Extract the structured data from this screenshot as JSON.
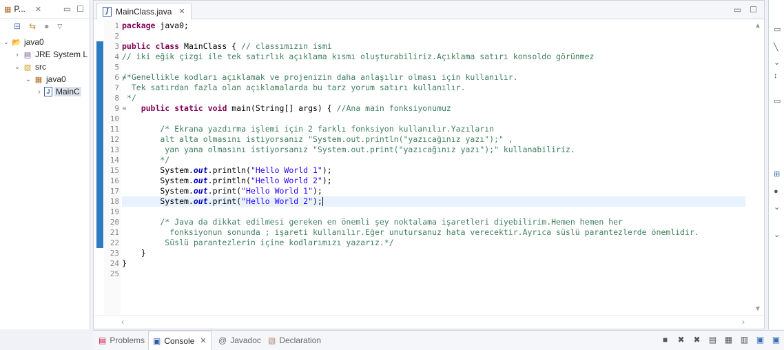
{
  "package_explorer": {
    "tab_title": "P...",
    "tree": [
      {
        "label": "java0",
        "level": 0,
        "expanded": true,
        "icon": "project-icon"
      },
      {
        "label": "JRE System L",
        "level": 1,
        "expanded": false,
        "icon": "library-icon"
      },
      {
        "label": "src",
        "level": 1,
        "expanded": true,
        "icon": "source-folder-icon"
      },
      {
        "label": "java0",
        "level": 2,
        "expanded": true,
        "icon": "package-icon"
      },
      {
        "label": "MainC",
        "level": 3,
        "expanded": false,
        "icon": "java-file-icon",
        "selected": true
      }
    ]
  },
  "editor": {
    "tab_title": "MainClass.java",
    "highlighted_line": 18,
    "line_numbers": [
      "1",
      "2",
      "3",
      "4",
      "5",
      "6",
      "7",
      "8",
      "9",
      "10",
      "11",
      "12",
      "13",
      "14",
      "15",
      "16",
      "17",
      "18",
      "19",
      "20",
      "21",
      "22",
      "23",
      "24",
      "25"
    ],
    "lines": [
      [
        {
          "t": "package",
          "c": "kw"
        },
        {
          "t": " java0;",
          "c": "pl"
        }
      ],
      [],
      [
        {
          "t": "public",
          "c": "kw"
        },
        {
          "t": " ",
          "c": "pl"
        },
        {
          "t": "class",
          "c": "kw"
        },
        {
          "t": " MainClass { ",
          "c": "pl"
        },
        {
          "t": "// classımızın ismi",
          "c": "cm"
        }
      ],
      [
        {
          "t": "// iki eğik çizgi ile tek satırlık açıklama kısmı oluşturabiliriz.Açıklama satırı konsoldo görünmez",
          "c": "cm"
        }
      ],
      [],
      [
        {
          "t": "/*Genellikle kodları açıklamak ve projenizin daha anlaşılır olması için kullanılır.",
          "c": "cm"
        }
      ],
      [
        {
          "t": "  Tek satırdan fazla olan açıklamalarda bu tarz yorum satırı kullanılır.",
          "c": "cm"
        }
      ],
      [
        {
          "t": " */",
          "c": "cm"
        }
      ],
      [
        {
          "t": "    ",
          "c": "pl"
        },
        {
          "t": "public",
          "c": "kw"
        },
        {
          "t": " ",
          "c": "pl"
        },
        {
          "t": "static",
          "c": "kw"
        },
        {
          "t": " ",
          "c": "pl"
        },
        {
          "t": "void",
          "c": "kw"
        },
        {
          "t": " main(String[] args) { ",
          "c": "pl"
        },
        {
          "t": "//Ana main fonksiyonumuz",
          "c": "cm"
        }
      ],
      [],
      [
        {
          "t": "        /* Ekrana yazdırma işlemi için 2 farklı fonksiyon kullanılır.Yazıların",
          "c": "cm"
        }
      ],
      [
        {
          "t": "        alt alta olmasını istiyorsanız \"System.out.println(\"yazıcağınız yazı\");\" ,",
          "c": "cm"
        }
      ],
      [
        {
          "t": "         yan yana olmasını istiyorsanız \"System.out.print(\"yazıcağınız yazı\");\" kullanabiliriz.",
          "c": "cm"
        }
      ],
      [
        {
          "t": "        */",
          "c": "cm"
        }
      ],
      [
        {
          "t": "        System.",
          "c": "pl"
        },
        {
          "t": "out",
          "c": "fd"
        },
        {
          "t": ".println(",
          "c": "pl"
        },
        {
          "t": "\"Hello World 1\"",
          "c": "st"
        },
        {
          "t": ");",
          "c": "pl"
        }
      ],
      [
        {
          "t": "        System.",
          "c": "pl"
        },
        {
          "t": "out",
          "c": "fd"
        },
        {
          "t": ".println(",
          "c": "pl"
        },
        {
          "t": "\"Hello World 2\"",
          "c": "st"
        },
        {
          "t": ");",
          "c": "pl"
        }
      ],
      [
        {
          "t": "        System.",
          "c": "pl"
        },
        {
          "t": "out",
          "c": "fd"
        },
        {
          "t": ".print(",
          "c": "pl"
        },
        {
          "t": "\"Hello World 1\"",
          "c": "st"
        },
        {
          "t": ");",
          "c": "pl"
        }
      ],
      [
        {
          "t": "        System.",
          "c": "pl"
        },
        {
          "t": "out",
          "c": "fd"
        },
        {
          "t": ".print(",
          "c": "pl"
        },
        {
          "t": "\"Hello World 2\"",
          "c": "st"
        },
        {
          "t": ");",
          "c": "pl"
        }
      ],
      [],
      [
        {
          "t": "        /* Java da dikkat edilmesi gereken en önemli şey noktalama işaretleri diyebilirim.Hemen hemen her",
          "c": "cm"
        }
      ],
      [
        {
          "t": "          fonksiyonun sonunda ; işareti kullanılır.Eğer unutursanuz hata verecektir.Ayrıca süslü parantezlerde önemlidir.",
          "c": "cm"
        }
      ],
      [
        {
          "t": "         Süslü parantezlerin içine kodlarımızı yazarız.*/",
          "c": "cm"
        }
      ],
      [
        {
          "t": "    }",
          "c": "pl"
        }
      ],
      [
        {
          "t": "}",
          "c": "pl"
        }
      ],
      []
    ]
  },
  "bottom_panel": {
    "tabs": [
      {
        "label": "Problems",
        "icon": "problems-icon",
        "active": false
      },
      {
        "label": "Console",
        "icon": "console-icon",
        "active": true
      },
      {
        "label": "Javadoc",
        "icon": "javadoc-icon",
        "active": false
      },
      {
        "label": "Declaration",
        "icon": "declaration-icon",
        "active": false
      }
    ]
  },
  "colors": {
    "keyword": "#7f0055",
    "comment": "#3f7f5f",
    "string": "#2a00ff",
    "field": "#0000c0",
    "current_line": "#e8f2fe",
    "ruler_mark": "#2c7cc0"
  }
}
